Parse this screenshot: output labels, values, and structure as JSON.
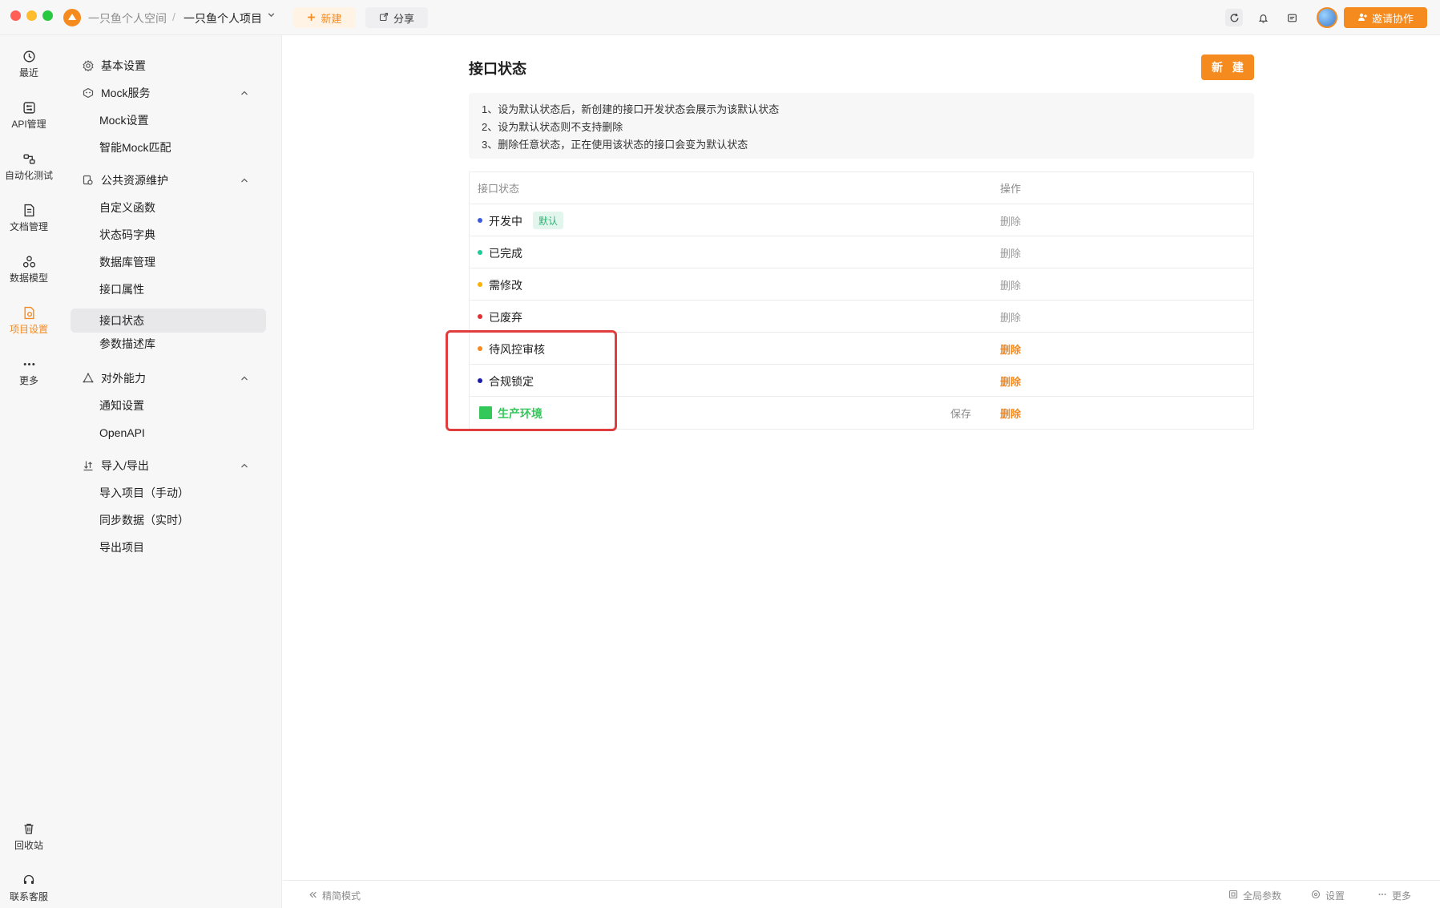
{
  "titlebar": {
    "workspace": "一只鱼个人空间",
    "separator": "/",
    "project": "一只鱼个人项目",
    "new_label": "新建",
    "share_label": "分享",
    "invite_label": "邀请协作"
  },
  "rail": {
    "items": [
      {
        "label": "最近",
        "icon": "clock-icon"
      },
      {
        "label": "API管理",
        "icon": "api-icon"
      },
      {
        "label": "自动化测试",
        "icon": "flow-icon"
      },
      {
        "label": "文档管理",
        "icon": "doc-icon"
      },
      {
        "label": "数据模型",
        "icon": "model-icon"
      },
      {
        "label": "项目设置",
        "icon": "settings-icon"
      },
      {
        "label": "更多",
        "icon": "more-icon"
      }
    ],
    "bottom": [
      {
        "label": "回收站",
        "icon": "trash-icon"
      },
      {
        "label": "联系客服",
        "icon": "headset-icon"
      }
    ]
  },
  "nav": {
    "basic": "基本设置",
    "mock": {
      "label": "Mock服务",
      "items": [
        "Mock设置",
        "智能Mock匹配"
      ]
    },
    "public": {
      "label": "公共资源维护",
      "items": [
        "自定义函数",
        "状态码字典",
        "数据库管理",
        "接口属性",
        "接口状态",
        "参数描述库"
      ]
    },
    "external": {
      "label": "对外能力",
      "items": [
        "通知设置",
        "OpenAPI"
      ]
    },
    "io": {
      "label": "导入/导出",
      "items": [
        "导入项目（手动）",
        "同步数据（实时）",
        "导出项目"
      ]
    },
    "active": "接口状态"
  },
  "main": {
    "title": "接口状态",
    "new_button": "新 建",
    "notes": [
      "1、设为默认状态后，新创建的接口开发状态会展示为该默认状态",
      "2、设为默认状态则不支持删除",
      "3、删除任意状态，正在使用该状态的接口会变为默认状态"
    ],
    "table": {
      "col_status": "接口状态",
      "col_action": "操作",
      "rows": [
        {
          "name": "开发中",
          "color": "#3b5bdb",
          "badge": "默认",
          "action": "删除",
          "enabled": false
        },
        {
          "name": "已完成",
          "color": "#20c997",
          "action": "删除",
          "enabled": false
        },
        {
          "name": "需修改",
          "color": "#fab005",
          "action": "删除",
          "enabled": false
        },
        {
          "name": "已废弃",
          "color": "#e03131",
          "action": "删除",
          "enabled": false
        },
        {
          "name": "待风控审核",
          "color": "#f58a1f",
          "action": "删除",
          "enabled": true
        },
        {
          "name": "合规锁定",
          "color": "#1c1ca8",
          "action": "删除",
          "enabled": true
        },
        {
          "name": "生产环境",
          "color": "#34c759",
          "save": "保存",
          "action": "删除",
          "enabled": true
        }
      ]
    }
  },
  "bottombar": {
    "compact_mode": "精简模式",
    "global_params": "全局参数",
    "settings": "设置",
    "more": "更多"
  },
  "colors": {
    "accent": "#f58a1f",
    "highlight": "#e03e3e",
    "default_badge": "#2bb673"
  }
}
